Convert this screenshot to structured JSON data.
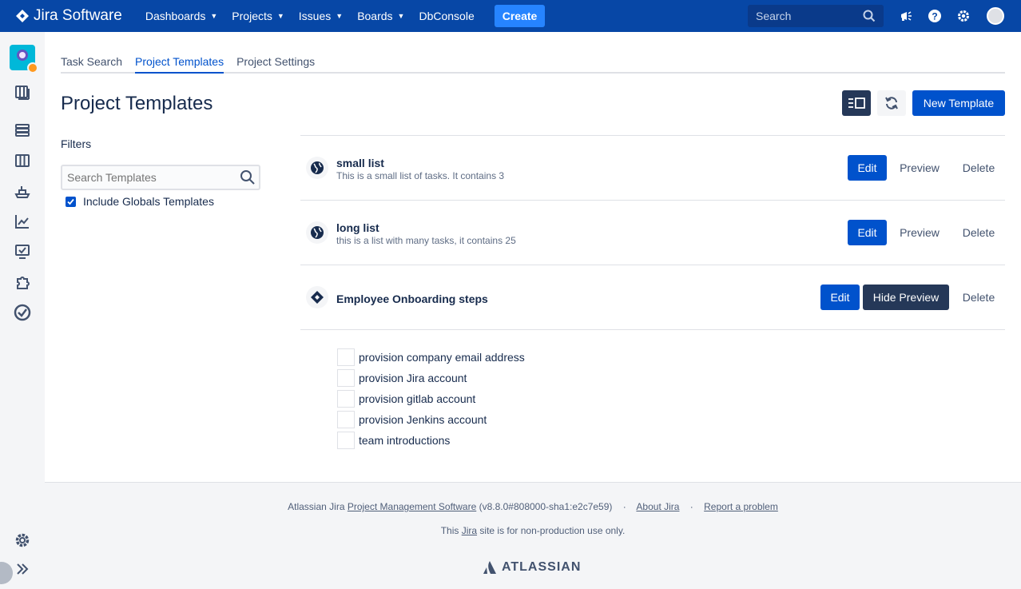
{
  "topnav": {
    "app_name": "Jira Software",
    "items": [
      {
        "label": "Dashboards",
        "has_dropdown": true
      },
      {
        "label": "Projects",
        "has_dropdown": true
      },
      {
        "label": "Issues",
        "has_dropdown": true
      },
      {
        "label": "Boards",
        "has_dropdown": true
      },
      {
        "label": "DbConsole",
        "has_dropdown": false
      }
    ],
    "create_label": "Create",
    "search_placeholder": "Search",
    "icons": [
      "notifications-icon",
      "help-icon",
      "settings-icon",
      "user-avatar"
    ]
  },
  "sidebar": {
    "icons": [
      "project-avatar",
      "backlog-icon",
      "releases-icon",
      "board-icon",
      "deployments-icon",
      "reports-icon",
      "issues-icon",
      "add-ons-icon",
      "tasks-icon",
      "settings-icon",
      "expand-icon"
    ]
  },
  "tabs": [
    {
      "label": "Task Search",
      "active": false
    },
    {
      "label": "Project Templates",
      "active": true
    },
    {
      "label": "Project Settings",
      "active": false
    }
  ],
  "page": {
    "title": "Project Templates",
    "new_template_label": "New Template"
  },
  "filters": {
    "label": "Filters",
    "search_placeholder": "Search Templates",
    "include_globals_label": "Include Globals Templates",
    "include_globals_checked": true
  },
  "templates": [
    {
      "name": "small list",
      "description": "This is a small list of tasks. It contains 3",
      "icon": "globe-icon",
      "edit": "Edit",
      "preview": "Preview",
      "delete": "Delete"
    },
    {
      "name": "long list",
      "description": "this is a list with many tasks, it contains 25",
      "icon": "globe-icon",
      "edit": "Edit",
      "preview": "Preview",
      "delete": "Delete"
    },
    {
      "name": "Employee Onboarding steps",
      "description": "",
      "icon": "project-diamond-icon",
      "edit": "Edit",
      "preview": "Hide Preview",
      "delete": "Delete"
    }
  ],
  "preview_items": [
    "provision company email address",
    "provision Jira account",
    "provision gitlab account",
    "provision Jenkins account",
    "team introductions"
  ],
  "footer": {
    "prefix": "Atlassian Jira",
    "pms_link": "Project Management Software",
    "version": "(v8.8.0#808000-sha1:e2c7e59)",
    "sep": "·",
    "about": "About Jira",
    "report": "Report a problem",
    "line2_pre": "This",
    "line2_link": "Jira",
    "line2_post": "site is for non-production use only.",
    "brand": "ATLASSIAN"
  },
  "colors": {
    "nav": "#0747A6",
    "primary": "#0052CC",
    "create": "#2684FF",
    "dark_button": "#253858"
  }
}
